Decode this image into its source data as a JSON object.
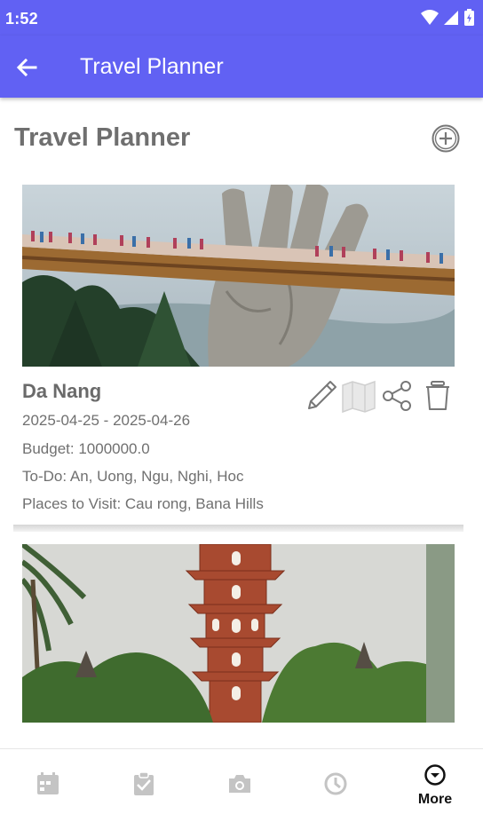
{
  "status": {
    "time": "1:52"
  },
  "appbar": {
    "title": "Travel Planner"
  },
  "page": {
    "title": "Travel Planner"
  },
  "trips": [
    {
      "name": "Da Nang",
      "dates": "2025-04-25 - 2025-04-26",
      "budget": "Budget: 1000000.0",
      "todo": "To-Do: An, Uong, Ngu, Nghi, Hoc",
      "places": "Places to Visit: Cau rong, Bana Hills"
    }
  ],
  "nav": {
    "more_label": "More"
  },
  "colors": {
    "primary": "#6161f3",
    "text_muted": "#707070"
  },
  "icons": [
    "back-arrow-icon",
    "add-circle-icon",
    "edit-pencil-icon",
    "map-icon",
    "share-icon",
    "trash-icon",
    "calendar-icon",
    "clipboard-icon",
    "camera-icon",
    "clock-icon",
    "chevron-circle-icon"
  ]
}
